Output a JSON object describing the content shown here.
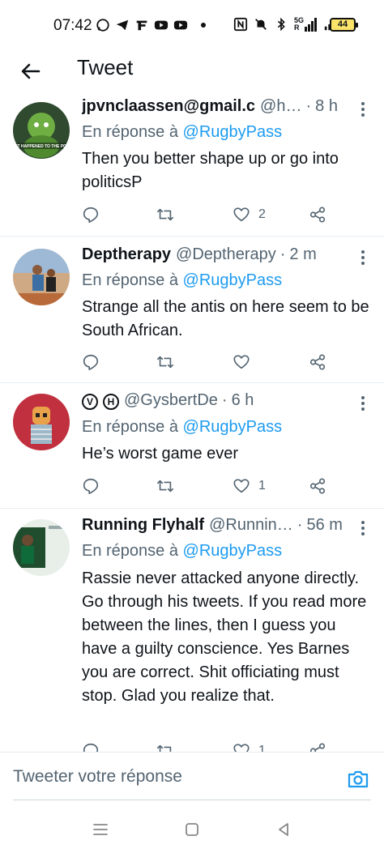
{
  "status_bar": {
    "time": "07:42",
    "left_icons": [
      "whatsapp-icon",
      "telegram-icon",
      "fnb-icon",
      "youtube-icon",
      "youtube-icon"
    ],
    "right_icons": [
      "nfc-icon",
      "mute-icon",
      "bluetooth-icon",
      "signal-5g-icon",
      "signal-icon"
    ],
    "network_label_top": "5G",
    "network_label_bottom": "R",
    "battery": "44"
  },
  "header": {
    "title": "Tweet"
  },
  "tweets": [
    {
      "name": "jpvnclaassen@gmail.c",
      "handle": "@h…",
      "time": "8 h",
      "reply_prefix": "En réponse à",
      "reply_to": "@RugbyPass",
      "text": "Then you better shape up or go into politicsP",
      "likes": "2",
      "avatar_caption": "IT HAPPENED TO THE PO"
    },
    {
      "name": "Deptherapy",
      "handle": "@Deptherapy",
      "time": "2 m",
      "reply_prefix": "En réponse à",
      "reply_to": "@RugbyPass",
      "text": "Strange all the antis on here seem to be South African.",
      "likes": ""
    },
    {
      "name_badge_1": "V",
      "name_badge_2": "H",
      "handle": "@GysbertDe",
      "time": "6 h",
      "reply_prefix": "En réponse à",
      "reply_to": "@RugbyPass",
      "text": "He’s worst game ever",
      "likes": "1"
    },
    {
      "name": "Running Flyhalf",
      "handle": "@Runnin…",
      "time": "56 m",
      "reply_prefix": "En réponse à",
      "reply_to": "@RugbyPass",
      "text": "Rassie never attacked anyone directly. Go through his tweets. If you read more between the lines, then I guess you have a guilty conscience. Yes Barnes you are correct. Shit officiating must stop. Glad you realize that.",
      "likes": "1"
    }
  ],
  "reply_bar": {
    "placeholder": "Tweeter votre réponse"
  },
  "colors": {
    "accent": "#1d9bf0",
    "text": "#0f1419",
    "secondary": "#536471",
    "divider": "#e6ecf0"
  }
}
